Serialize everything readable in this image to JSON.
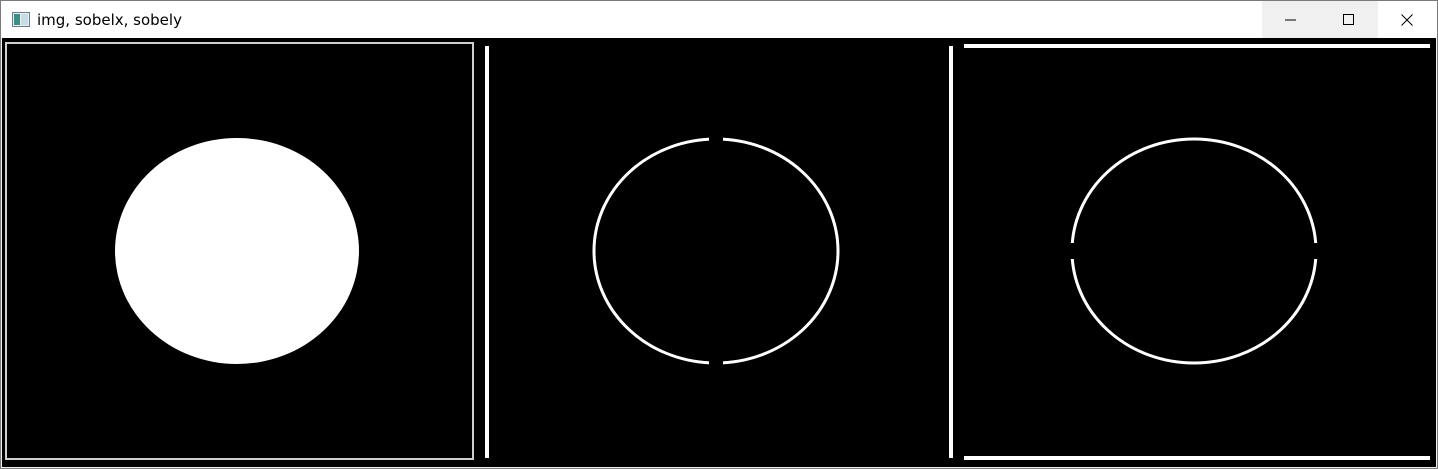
{
  "window": {
    "title": "img, sobelx, sobely"
  },
  "controls": {
    "minimize_icon": "minimize-icon",
    "maximize_icon": "maximize-icon",
    "close_icon": "close-icon"
  },
  "panels": [
    {
      "id": "img",
      "content": "filled white circle on black background"
    },
    {
      "id": "sobelx",
      "content": "circle edge outline with left vertical border line"
    },
    {
      "id": "sobely",
      "content": "circle edge outline with top and bottom horizontal border lines"
    }
  ],
  "colors": {
    "background": "#000000",
    "foreground": "#ffffff",
    "titlebar": "#ffffff",
    "window_frame": "#f0f0f0"
  }
}
